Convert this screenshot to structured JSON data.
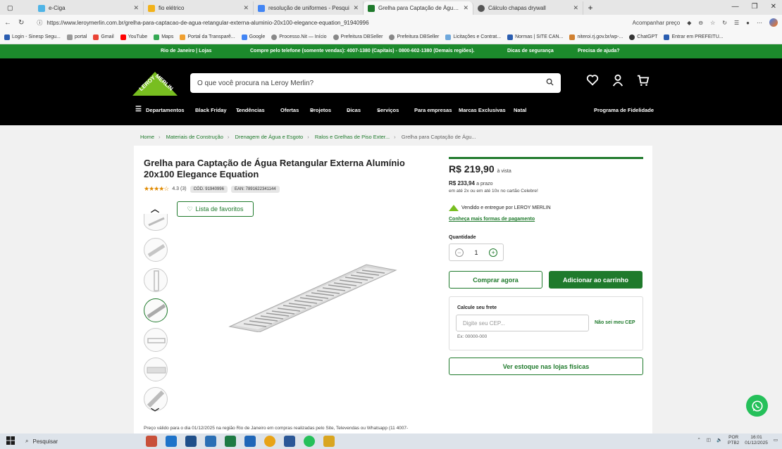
{
  "browser": {
    "tabs": [
      {
        "title": "e-Ciga",
        "active": false
      },
      {
        "title": "fio elétrico",
        "active": false
      },
      {
        "title": "resolução de uniformes - Pesqui",
        "active": false
      },
      {
        "title": "Grelha para Captação de Água Re",
        "active": true
      },
      {
        "title": "Cálculo chapas drywall",
        "active": false
      }
    ],
    "url": "https://www.leroymerlin.com.br/grelha-para-captacao-de-agua-retangular-externa-aluminio-20x100-elegance-equation_91940996",
    "track_price": "Acompanhar preço",
    "bookmarks": [
      "Login - Sinesp Segu...",
      "portal",
      "Gmail",
      "YouTube",
      "Maps",
      "Portal da Transparê...",
      "Google",
      "Processo.Nit — Início",
      "Prefeitura DBSeller",
      "Prefeitura DBSeller",
      "Licitações e Contrat...",
      "Normas | SITE CAN...",
      "niteroi.rj.gov.br/wp-...",
      "ChatGPT",
      "Entrar em PREFEITU..."
    ]
  },
  "topbar": {
    "location": "Rio de Janeiro  |  Lojas",
    "phone": "Compre pelo telefone (somente vendas): 4007-1380 (Capitais) - 0800-602-1380 (Demais regiões).",
    "security": "Dicas de segurança",
    "help": "Precisa de ajuda?"
  },
  "header": {
    "logo_text": "LEROY MERLIN",
    "search_placeholder": "O que você procura na Leroy Merlin?",
    "nav": [
      "Departamentos",
      "Black Friday",
      "Tendências",
      "Ofertas",
      "Projetos",
      "Dicas",
      "Serviços",
      "Para empresas",
      "Marcas Exclusivas",
      "Natal"
    ],
    "loyalty": "Programa de Fidelidade"
  },
  "breadcrumb": [
    "Home",
    "Materiais de Construção",
    "Drenagem de Água e Esgoto",
    "Ralos e Grelhas de Piso Exter...",
    "Grelha para Captação de Águ..."
  ],
  "product": {
    "title": "Grelha para Captação de Água Retangular Externa Alumínio 20x100 Elegance Equation",
    "stars": "★★★★☆",
    "rating": "4.3 (3)",
    "cod": "CÓD. 91940996",
    "ean": "EAN: 7891622341144",
    "favorites": "Lista de favoritos",
    "price": "R$ 219,90",
    "price_suffix": "à vista",
    "price_term": "R$ 233,94",
    "price_term_suffix": "a prazo",
    "installments": "em até 2x ou em até 10x no cartão Celebre!",
    "seller": "Vendido e entregue por LEROY MERLIN",
    "payment_link": "Conheça mais formas de pagamento",
    "quantity_label": "Quantidade",
    "quantity": "1",
    "buy_now": "Comprar agora",
    "add_cart": "Adicionar ao carrinho",
    "shipping_label": "Calcule seu frete",
    "cep_placeholder": "Digite seu CEP...",
    "no_cep": "Não sei meu CEP",
    "cep_example": "Ex: 00000-000",
    "stock": "Ver estoque nas lojas físicas",
    "note": "Preço válido para o dia 01/12/2025 na região Rio de Janeiro em compras realizadas pelo Site, Televendas ou Whatsapp (11 4007-"
  },
  "taskbar": {
    "search": "Pesquisar",
    "lang": "POR",
    "lang2": "PTB2",
    "time": "16:01",
    "date": "01/12/2025"
  },
  "colors": {
    "brand_green": "#1f7a2c",
    "topbar_green": "#1c8a2c",
    "header_bg": "#000000",
    "whatsapp": "#25c05a"
  }
}
